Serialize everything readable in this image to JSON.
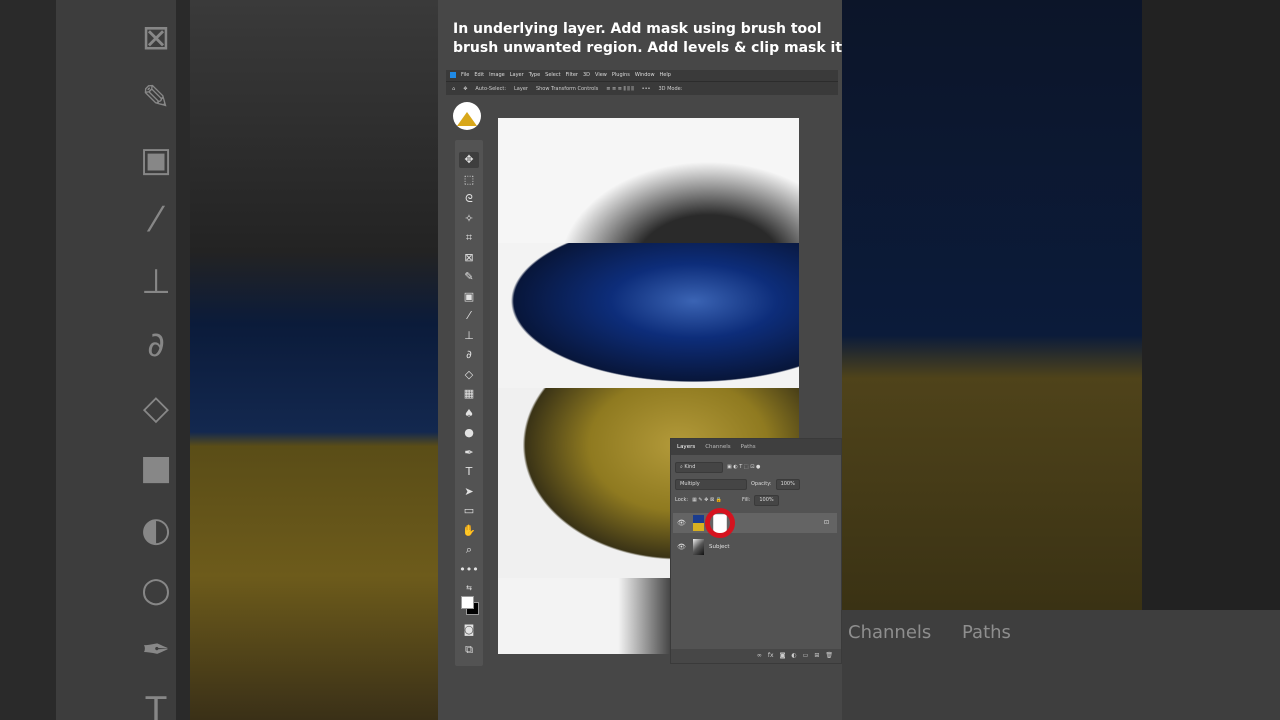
{
  "caption": {
    "line1": "In underlying layer. Add mask using brush tool",
    "line2": "brush unwanted region. Add levels & clip mask it"
  },
  "menu": [
    "File",
    "Edit",
    "Image",
    "Layer",
    "Type",
    "Select",
    "Filter",
    "3D",
    "View",
    "Plugins",
    "Window",
    "Help"
  ],
  "options_bar": {
    "auto_select": "Auto-Select:",
    "target": "Layer",
    "show_transform": "Show Transform Controls",
    "mode_3d": "3D Mode:"
  },
  "toolbar_icons": [
    "move-icon",
    "marquee-icon",
    "lasso-icon",
    "quick-select-icon",
    "crop-icon",
    "frame-icon",
    "eyedropper-icon",
    "healing-icon",
    "brush-icon",
    "stamp-icon",
    "history-brush-icon",
    "eraser-icon",
    "gradient-icon",
    "blur-icon",
    "dodge-icon",
    "pen-icon",
    "type-icon",
    "path-select-icon",
    "rectangle-icon",
    "hand-icon",
    "zoom-icon",
    "more-icon"
  ],
  "layers_panel": {
    "tabs": [
      "Layers",
      "Channels",
      "Paths"
    ],
    "kind": "Kind",
    "blend_mode": "Multiply",
    "opacity_label": "Opacity:",
    "opacity_value": "100%",
    "lock_label": "Lock:",
    "fill_label": "Fill:",
    "fill_value": "100%",
    "layers": [
      {
        "name": ""
      },
      {
        "name": "Subject"
      }
    ]
  },
  "background_panel": {
    "tabs": [
      "Channels",
      "Paths"
    ]
  },
  "colors": {
    "flag_blue": "#0d2d7a",
    "flag_yellow": "#d8b020",
    "highlight_ring": "#d5131f"
  }
}
